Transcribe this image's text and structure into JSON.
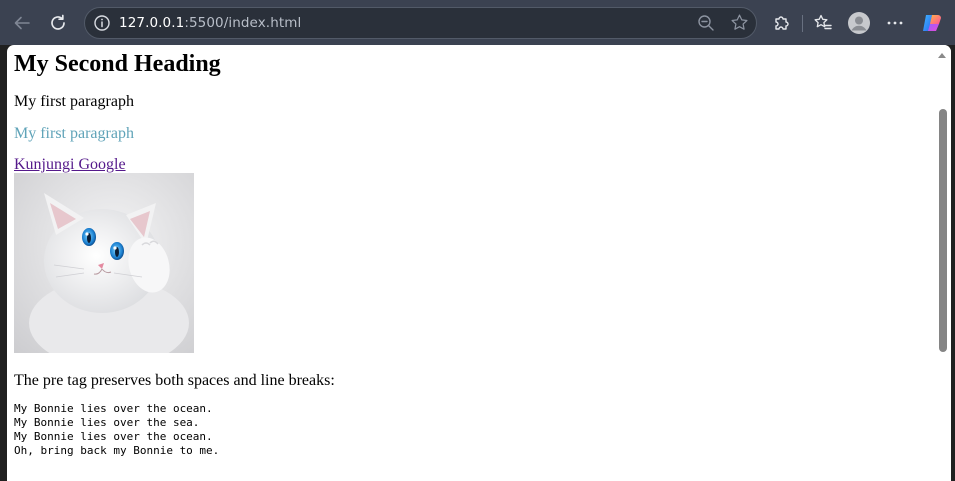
{
  "browser": {
    "url_host": "127.0.0.1",
    "url_rest": ":5500/index.html"
  },
  "page": {
    "heading": "My Second Heading",
    "paragraph_1": "My first paragraph",
    "paragraph_2": "My first paragraph",
    "paragraph_2_color": "#5fa3b8",
    "link_text": "Kunjungi Google",
    "pre_intro": "The pre tag preserves both spaces and line breaks:",
    "pre_lines": [
      "My Bonnie lies over the ocean.",
      "My Bonnie lies over the sea.",
      "My Bonnie lies over the ocean.",
      "Oh, bring back my Bonnie to me."
    ]
  },
  "icons": {
    "back": "arrow-left-icon",
    "reload": "reload-icon",
    "site_info": "info-icon",
    "zoom": "zoom-out-icon",
    "favorite": "star-icon",
    "extensions": "puzzle-icon",
    "favorites_list": "favorites-icon",
    "profile": "avatar-icon",
    "menu": "more-icon",
    "copilot": "copilot-icon"
  }
}
